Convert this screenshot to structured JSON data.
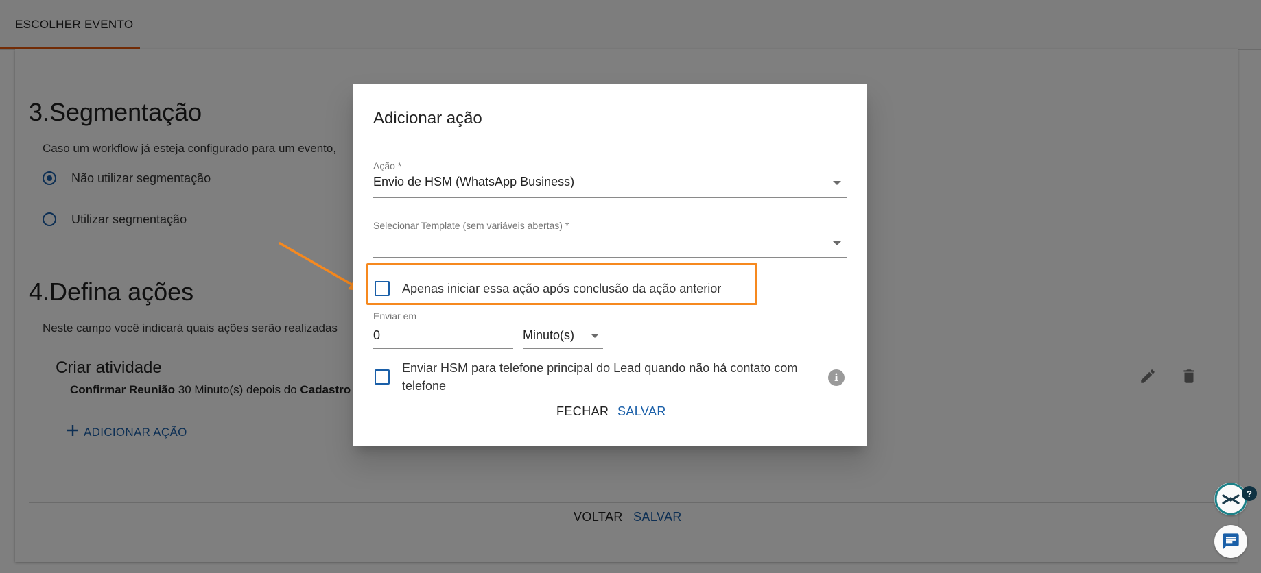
{
  "tabs": {
    "active_label": "ESCOLHER EVENTO"
  },
  "segmentation": {
    "title": "3.Segmentação",
    "description": "Caso um workflow já esteja configurado para um evento,",
    "options": [
      {
        "label": "Não utilizar segmentação",
        "selected": true
      },
      {
        "label": "Utilizar segmentação",
        "selected": false
      }
    ]
  },
  "actions_section": {
    "title": "4.Defina ações",
    "description": "Neste campo você indicará quais ações serão realizadas",
    "activity": {
      "title": "Criar atividade",
      "desc_bold1": "Confirmar Reunião",
      "desc_mid": " 30 Minuto(s) depois do ",
      "desc_bold2": "Cadastro"
    },
    "add_action_label": "ADICIONAR AÇÃO",
    "add_icon": "plus-icon",
    "edit_icon": "pencil-icon",
    "delete_icon": "trash-icon"
  },
  "page_footer": {
    "back_label": "VOLTAR",
    "save_label": "SALVAR"
  },
  "dialog": {
    "title": "Adicionar ação",
    "action_field": {
      "label": "Ação *",
      "value": "Envio de HSM (WhatsApp Business)"
    },
    "template_field": {
      "label": "Selecionar Template (sem variáveis abertas) *",
      "value": ""
    },
    "wait_previous_checkbox": {
      "label": "Apenas iniciar essa ação após conclusão da ação anterior",
      "checked": false
    },
    "send_in": {
      "label": "Enviar em",
      "value": "0",
      "unit": "Minuto(s)"
    },
    "send_main_phone_checkbox": {
      "label": "Enviar HSM para telefone principal do Lead quando não há contato com telefone",
      "checked": false
    },
    "info_icon": "info-icon",
    "close_label": "FECHAR",
    "save_label": "SALVAR"
  },
  "widgets": {
    "help_badge": "?",
    "help_icon": "chevrons-icon",
    "chat_icon": "chat-icon"
  },
  "colors": {
    "primary": "#1a5fa8",
    "tab_indicator": "#e8590c",
    "highlight": "#f6891f",
    "overlay": "rgba(0,0,0,0.5)"
  }
}
